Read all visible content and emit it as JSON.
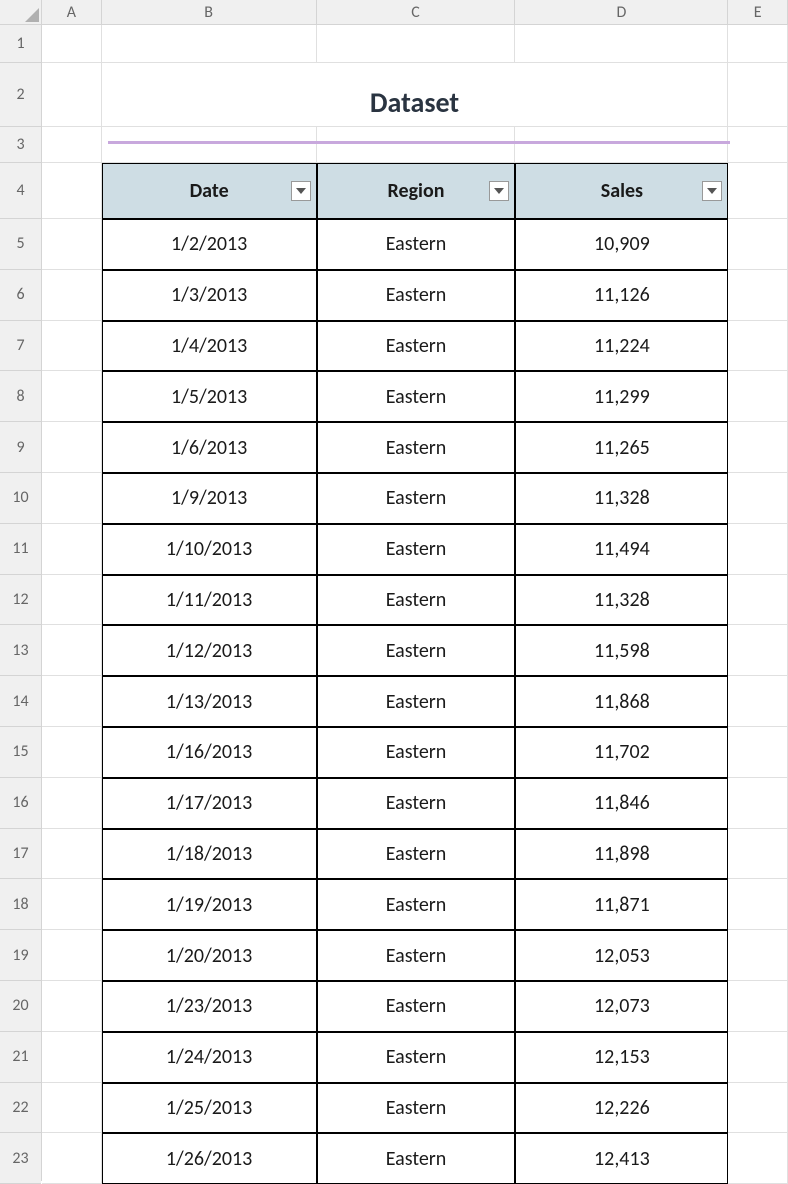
{
  "columns": [
    "A",
    "B",
    "C",
    "D",
    "E"
  ],
  "row_numbers": [
    1,
    2,
    3,
    4,
    5,
    6,
    7,
    8,
    9,
    10,
    11,
    12,
    13,
    14,
    15,
    16,
    17,
    18,
    19,
    20,
    21,
    22,
    23
  ],
  "title": "Dataset",
  "table": {
    "headers": [
      "Date",
      "Region",
      "Sales"
    ],
    "rows": [
      {
        "date": "1/2/2013",
        "region": "Eastern",
        "sales": "10,909"
      },
      {
        "date": "1/3/2013",
        "region": "Eastern",
        "sales": "11,126"
      },
      {
        "date": "1/4/2013",
        "region": "Eastern",
        "sales": "11,224"
      },
      {
        "date": "1/5/2013",
        "region": "Eastern",
        "sales": "11,299"
      },
      {
        "date": "1/6/2013",
        "region": "Eastern",
        "sales": "11,265"
      },
      {
        "date": "1/9/2013",
        "region": "Eastern",
        "sales": "11,328"
      },
      {
        "date": "1/10/2013",
        "region": "Eastern",
        "sales": "11,494"
      },
      {
        "date": "1/11/2013",
        "region": "Eastern",
        "sales": "11,328"
      },
      {
        "date": "1/12/2013",
        "region": "Eastern",
        "sales": "11,598"
      },
      {
        "date": "1/13/2013",
        "region": "Eastern",
        "sales": "11,868"
      },
      {
        "date": "1/16/2013",
        "region": "Eastern",
        "sales": "11,702"
      },
      {
        "date": "1/17/2013",
        "region": "Eastern",
        "sales": "11,846"
      },
      {
        "date": "1/18/2013",
        "region": "Eastern",
        "sales": "11,898"
      },
      {
        "date": "1/19/2013",
        "region": "Eastern",
        "sales": "11,871"
      },
      {
        "date": "1/20/2013",
        "region": "Eastern",
        "sales": "12,053"
      },
      {
        "date": "1/23/2013",
        "region": "Eastern",
        "sales": "12,073"
      },
      {
        "date": "1/24/2013",
        "region": "Eastern",
        "sales": "12,153"
      },
      {
        "date": "1/25/2013",
        "region": "Eastern",
        "sales": "12,226"
      },
      {
        "date": "1/26/2013",
        "region": "Eastern",
        "sales": "12,413"
      }
    ]
  }
}
